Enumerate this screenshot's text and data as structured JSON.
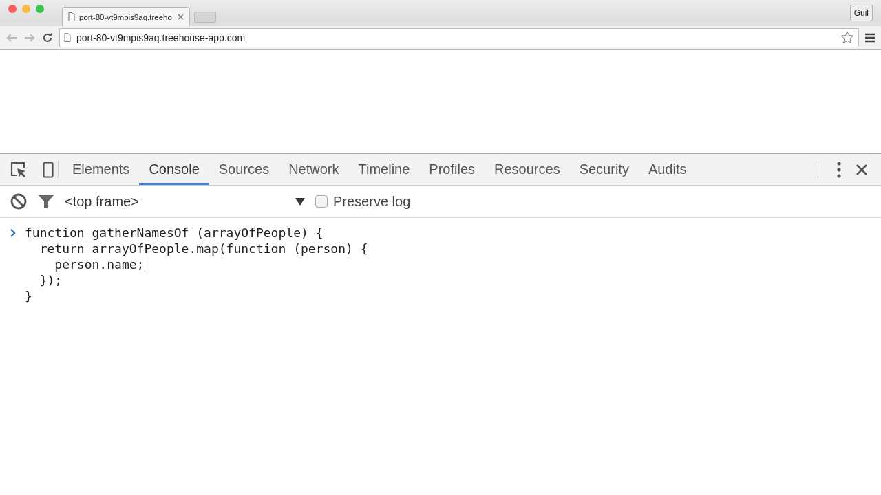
{
  "browser": {
    "tabs": [
      {
        "title": "port-80-vt9mpis9aq.treeho",
        "selected": true
      }
    ],
    "profile": "Guil",
    "address": "port-80-vt9mpis9aq.treehouse-app.com"
  },
  "devtools": {
    "tabs": [
      {
        "label": "Elements",
        "selected": false
      },
      {
        "label": "Console",
        "selected": true
      },
      {
        "label": "Sources",
        "selected": false
      },
      {
        "label": "Network",
        "selected": false
      },
      {
        "label": "Timeline",
        "selected": false
      },
      {
        "label": "Profiles",
        "selected": false
      },
      {
        "label": "Resources",
        "selected": false
      },
      {
        "label": "Security",
        "selected": false
      },
      {
        "label": "Audits",
        "selected": false
      }
    ],
    "context": "<top frame>",
    "preserve_log": {
      "label": "Preserve log",
      "checked": false
    },
    "console_input": [
      {
        "text": "function gatherNamesOf (arrayOfPeople) {",
        "caret": false
      },
      {
        "text": "  return arrayOfPeople.map(function (person) {",
        "caret": false
      },
      {
        "text": "    person.name;",
        "caret": true
      },
      {
        "text": "  });",
        "caret": false
      },
      {
        "text": "}",
        "caret": false
      }
    ]
  }
}
